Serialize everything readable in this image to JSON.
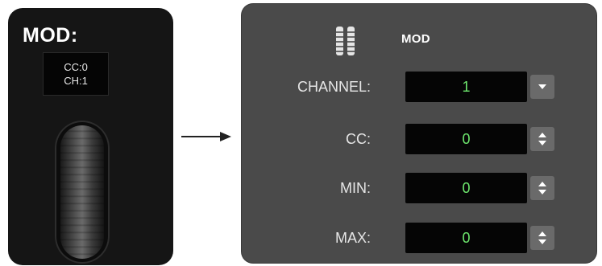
{
  "hardware": {
    "title": "MOD:",
    "screen_cc": "CC:0",
    "screen_ch": "CH:1"
  },
  "software": {
    "title": "MOD",
    "fields": [
      {
        "label": "CHANNEL:",
        "value": "1",
        "control": "dropdown-arrow-icon"
      },
      {
        "label": "CC:",
        "value": "0",
        "control": "stepper-arrows-icon"
      },
      {
        "label": "MIN:",
        "value": "0",
        "control": "stepper-arrows-icon"
      },
      {
        "label": "MAX:",
        "value": "0",
        "control": "stepper-arrows-icon"
      }
    ]
  },
  "colors": {
    "value_text": "#6ee86e",
    "panel_bg": "#4a4a4a",
    "hardware_bg": "#151515"
  }
}
